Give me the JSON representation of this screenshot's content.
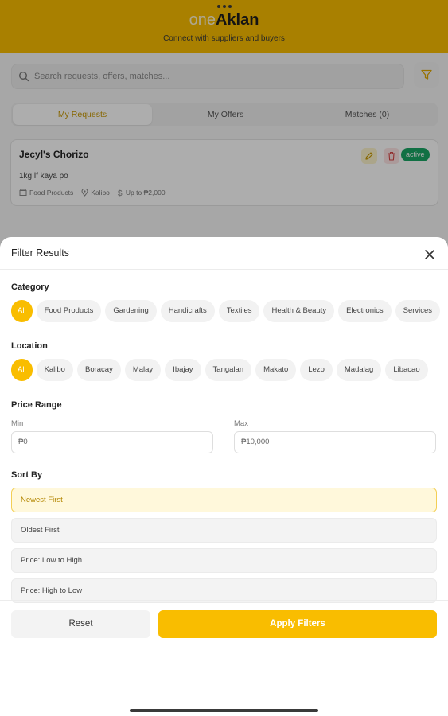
{
  "app": {
    "brand_prefix": "one",
    "brand_name": "Aklan",
    "tagline": "Connect with suppliers and buyers",
    "search_placeholder": "Search requests, offers, matches...",
    "tabs": [
      "My Requests",
      "My Offers",
      "Matches (0)"
    ],
    "card": {
      "title": "Jecyl's Chorizo",
      "description": "1kg lf kaya po",
      "category": "Food Products",
      "location": "Kalibo",
      "budget": "Up to ₱2,000",
      "status": "active"
    }
  },
  "filter": {
    "title": "Filter Results",
    "category_label": "Category",
    "categories": [
      "All",
      "Food Products",
      "Gardening",
      "Handicrafts",
      "Textiles",
      "Health & Beauty",
      "Electronics",
      "Services"
    ],
    "location_label": "Location",
    "locations": [
      "All",
      "Kalibo",
      "Boracay",
      "Malay",
      "Ibajay",
      "Tangalan",
      "Makato",
      "Lezo",
      "Madalag",
      "Libacao"
    ],
    "price_label": "Price Range",
    "min_label": "Min",
    "max_label": "Max",
    "min_value": "₱0",
    "max_value": "₱10,000",
    "sort_label": "Sort By",
    "sort_options": [
      "Newest First",
      "Oldest First",
      "Price: Low to High",
      "Price: High to Low"
    ],
    "reset": "Reset",
    "apply": "Apply Filters"
  },
  "colors": {
    "accent": "#f9bd00",
    "badge": "#1aa565"
  }
}
